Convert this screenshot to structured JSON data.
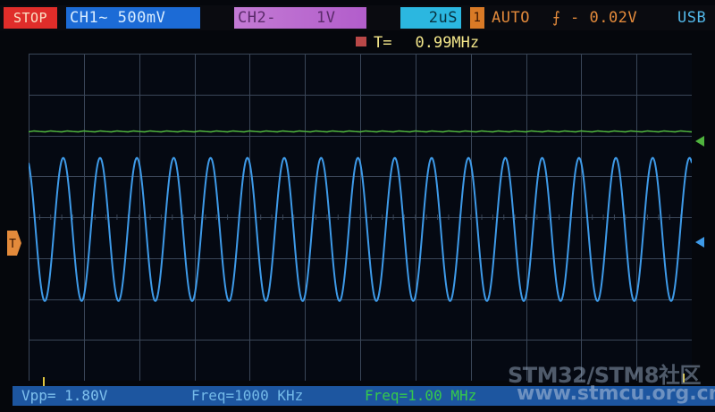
{
  "status": {
    "run_state": "STOP",
    "ch1": "CH1~ 500mV",
    "ch2_name": "CH2-",
    "ch2_scale": "1V",
    "timebase": "2uS",
    "trigger_source": "1",
    "trigger_mode": "AUTO",
    "trigger_edge": "⨍",
    "trigger_level": "- 0.02V",
    "usb": "USB"
  },
  "period": {
    "label": "T=",
    "value": "0.99MHz"
  },
  "measurements": {
    "vpp": "Vpp=  1.80V",
    "freq": "Freq=1000 KHz",
    "freq_hw": "Freq=1.00 MHz"
  },
  "markers": {
    "trigger": "T"
  },
  "watermark": {
    "line1": "STM32/STM8社区",
    "line2": "www.stmcu.org.cn"
  },
  "colors": {
    "grid": "#3a4658",
    "ch1_trace": "#3e9ae8",
    "ch2_trace": "#4fb33e",
    "trigger": "#e38a3b"
  },
  "chart_data": {
    "type": "line",
    "grid": true,
    "x_divisions": 12,
    "y_divisions": 8,
    "series": [
      {
        "name": "CH1",
        "waveform": "sine",
        "cycles": 18,
        "amplitude_div": 1.75,
        "offset_div": -0.3
      },
      {
        "name": "CH2",
        "waveform": "dc",
        "offset_div": 2.1
      }
    ]
  }
}
